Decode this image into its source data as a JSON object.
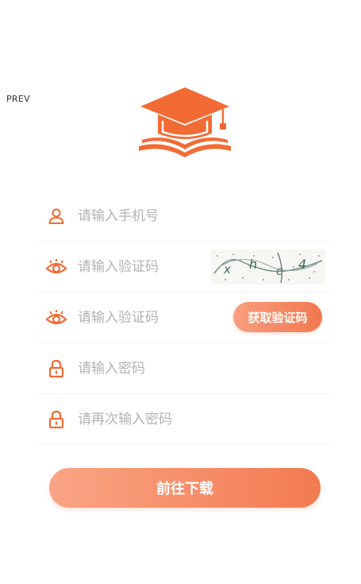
{
  "nav": {
    "prev_label": "PREV"
  },
  "colors": {
    "accent": "#F26B35",
    "accent_light": "#F8A07F",
    "placeholder": "#B3B3B3"
  },
  "form": {
    "phone": {
      "placeholder": "请输入手机号",
      "value": "",
      "icon": "user-icon"
    },
    "image_code": {
      "placeholder": "请输入验证码",
      "value": "",
      "icon": "eye-icon",
      "captcha_text": "xhc4"
    },
    "sms_code": {
      "placeholder": "请输入验证码",
      "value": "",
      "icon": "eye-icon",
      "button_label": "获取验证码"
    },
    "password": {
      "placeholder": "请输入密码",
      "value": "",
      "icon": "lock-icon"
    },
    "password_confirm": {
      "placeholder": "请再次输入密码",
      "value": "",
      "icon": "lock-icon"
    }
  },
  "submit": {
    "label": "前往下载"
  }
}
